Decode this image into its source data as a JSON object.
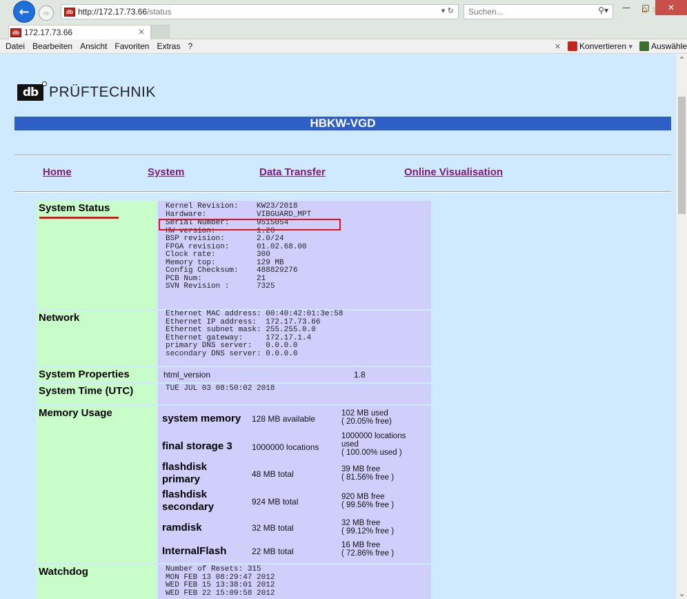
{
  "browser": {
    "url_host": "http://172.17.73.66",
    "url_path": "/status",
    "search_placeholder": "Suchen...",
    "tab_title": "172.17.73.66",
    "favicon_text": "db",
    "menu": [
      "Datei",
      "Bearbeiten",
      "Ansicht",
      "Favoriten",
      "Extras",
      "?"
    ],
    "menubar_right": {
      "convert_label": "Konvertieren",
      "select_label": "Auswähle"
    }
  },
  "page": {
    "logo_text": "PRÜFTECHNIK",
    "device_name": "HBKW-VGD",
    "nav": [
      "Home",
      "System",
      "Data Transfer",
      "Online Visualisation"
    ]
  },
  "system_status": {
    "label": "System Status",
    "lines_before": "Kernel Revision:    KW23/2018\nHardware:           VIBGUARD_MPT",
    "serial_line": "Serial Number:      9515054",
    "lines_after": "HW version:         1.20\nBSP revision:       2.0/24\nFPGA revision:      01.02.68.00\nClock rate:         300\nMemory top:         129 MB\nConfig Checksum:    488829276\nPCB Num:            21\nSVN Revision :      7325"
  },
  "network": {
    "label": "Network",
    "text": "Ethernet MAC address: 00:40:42:01:3e:58\nEthernet IP address:  172.17.73.66\nEthernet subnet mask: 255.255.0.0\nEthernet gateway:     172.17.1.4\nprimary DNS server:   0.0.0.0\nsecondary DNS server: 0.0.0.0"
  },
  "system_properties": {
    "label": "System Properties",
    "key": "html_version",
    "value": "1.8"
  },
  "system_time": {
    "label": "System Time (UTC)",
    "value": "TUE JUL 03 08:50:02 2018"
  },
  "memory_usage": {
    "label": "Memory Usage",
    "rows": [
      {
        "name": "system memory",
        "total": "128 MB available",
        "used": "102 MB used\n( 20.05% free)"
      },
      {
        "name": "final storage 3",
        "total": "1000000 locations",
        "used": "1000000 locations\nused\n( 100.00% used )"
      },
      {
        "name": "flashdisk\nprimary",
        "total": "48 MB total",
        "used": "39 MB free\n( 81.56% free )"
      },
      {
        "name": "flashdisk\nsecondary",
        "total": "924 MB total",
        "used": "920 MB free\n( 99.56% free )"
      },
      {
        "name": "ramdisk",
        "total": "32 MB total",
        "used": "32 MB free\n( 99.12% free )"
      },
      {
        "name": "InternalFlash",
        "total": "22 MB total",
        "used": "16 MB free\n( 72.86% free )"
      }
    ]
  },
  "watchdog": {
    "label": "Watchdog",
    "text": "Number of Resets: 315\nMON FEB 13 08:29:47 2012\nWED FEB 15 13:38:01 2012\nWED FEB 22 15:09:58 2012"
  }
}
